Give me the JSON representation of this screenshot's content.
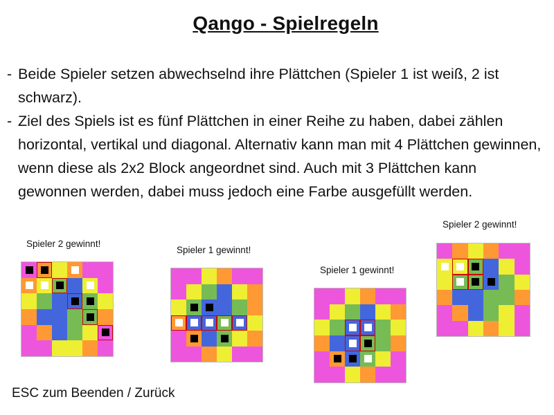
{
  "title": "Qango - Spielregeln",
  "rules": [
    "Beide Spieler setzen abwechselnd ihre Plättchen (Spieler 1 ist weiß, 2 ist schwarz).",
    "Ziel des Spiels ist es fünf Plättchen in einer Reihe zu haben, dabei zählen horizontal, vertikal und diagonal. Alternativ kann man mit 4 Plättchen gewinnen, wenn diese als 2x2 Block angeordnet sind. Auch mit 3 Plättchen kann gewonnen werden, dabei muss jedoch eine Farbe ausgefüllt werden."
  ],
  "rule_bullet": "-",
  "footer": "ESC zum Beenden / Zurück",
  "colors": {
    "M": "#ee55dd",
    "O": "#ff9933",
    "Y": "#eeee33",
    "G": "#77bb55",
    "B": "#4466dd",
    "stone_white": "#ffffff",
    "stone_black": "#000000",
    "win_highlight": "#cc0000"
  },
  "example_boards": [
    {
      "caption": "Spieler 2 gewinnt!",
      "winner": 2,
      "win_type": "diagonal five in a row",
      "cells": [
        [
          "M",
          "O",
          "Y",
          "O",
          "M",
          "M"
        ],
        [
          "O",
          "Y",
          "G",
          "B",
          "Y",
          "M"
        ],
        [
          "Y",
          "G",
          "B",
          "B",
          "G",
          "Y"
        ],
        [
          "O",
          "B",
          "B",
          "G",
          "G",
          "O"
        ],
        [
          "M",
          "O",
          "B",
          "G",
          "Y",
          "M"
        ],
        [
          "M",
          "M",
          "Y",
          "Y",
          "O",
          "M"
        ]
      ],
      "stones": [
        {
          "row": 0,
          "col": 0,
          "color": "black"
        },
        {
          "row": 0,
          "col": 1,
          "color": "black"
        },
        {
          "row": 0,
          "col": 3,
          "color": "white"
        },
        {
          "row": 1,
          "col": 0,
          "color": "white"
        },
        {
          "row": 1,
          "col": 1,
          "color": "white"
        },
        {
          "row": 1,
          "col": 2,
          "color": "black"
        },
        {
          "row": 1,
          "col": 4,
          "color": "white"
        },
        {
          "row": 2,
          "col": 3,
          "color": "black"
        },
        {
          "row": 2,
          "col": 4,
          "color": "black"
        },
        {
          "row": 3,
          "col": 4,
          "color": "black"
        },
        {
          "row": 4,
          "col": 5,
          "color": "black"
        }
      ],
      "highlights": [
        [
          0,
          1
        ],
        [
          1,
          2
        ],
        [
          2,
          3
        ],
        [
          3,
          4
        ],
        [
          4,
          5
        ]
      ]
    },
    {
      "caption": "Spieler 1 gewinnt!",
      "winner": 1,
      "win_type": "horizontal five in a row",
      "cells": [
        [
          "M",
          "M",
          "Y",
          "O",
          "M",
          "M"
        ],
        [
          "M",
          "Y",
          "G",
          "B",
          "Y",
          "O"
        ],
        [
          "Y",
          "G",
          "B",
          "B",
          "G",
          "O"
        ],
        [
          "O",
          "B",
          "B",
          "G",
          "B",
          "Y"
        ],
        [
          "M",
          "O",
          "B",
          "G",
          "Y",
          "O"
        ],
        [
          "M",
          "M",
          "O",
          "Y",
          "M",
          "M"
        ]
      ],
      "stones": [
        {
          "row": 2,
          "col": 1,
          "color": "black"
        },
        {
          "row": 2,
          "col": 2,
          "color": "black"
        },
        {
          "row": 3,
          "col": 0,
          "color": "white"
        },
        {
          "row": 3,
          "col": 1,
          "color": "white"
        },
        {
          "row": 3,
          "col": 2,
          "color": "white"
        },
        {
          "row": 3,
          "col": 3,
          "color": "white"
        },
        {
          "row": 3,
          "col": 4,
          "color": "white"
        },
        {
          "row": 4,
          "col": 1,
          "color": "black"
        },
        {
          "row": 4,
          "col": 3,
          "color": "black"
        }
      ],
      "highlights": [
        [
          3,
          0
        ],
        [
          3,
          1
        ],
        [
          3,
          2
        ],
        [
          3,
          3
        ],
        [
          3,
          4
        ]
      ]
    },
    {
      "caption": "Spieler 1 gewinnt!",
      "winner": 1,
      "win_type": "2x2 block",
      "cells": [
        [
          "M",
          "M",
          "Y",
          "O",
          "M",
          "M"
        ],
        [
          "M",
          "Y",
          "G",
          "B",
          "Y",
          "O"
        ],
        [
          "Y",
          "G",
          "B",
          "B",
          "G",
          "Y"
        ],
        [
          "O",
          "B",
          "B",
          "G",
          "G",
          "O"
        ],
        [
          "M",
          "O",
          "B",
          "G",
          "Y",
          "M"
        ],
        [
          "M",
          "M",
          "Y",
          "O",
          "M",
          "M"
        ]
      ],
      "stones": [
        {
          "row": 2,
          "col": 2,
          "color": "white"
        },
        {
          "row": 2,
          "col": 3,
          "color": "white"
        },
        {
          "row": 3,
          "col": 2,
          "color": "white"
        },
        {
          "row": 3,
          "col": 3,
          "color": "black"
        },
        {
          "row": 4,
          "col": 1,
          "color": "black"
        },
        {
          "row": 4,
          "col": 2,
          "color": "black"
        },
        {
          "row": 4,
          "col": 3,
          "color": "white"
        }
      ],
      "highlights": [
        [
          2,
          2
        ],
        [
          2,
          3
        ],
        [
          3,
          2
        ],
        [
          3,
          3
        ]
      ]
    },
    {
      "caption": "Spieler 2 gewinnt!",
      "winner": 2,
      "win_type": "three stones fill a color",
      "cells": [
        [
          "M",
          "O",
          "Y",
          "O",
          "M",
          "M"
        ],
        [
          "Y",
          "Y",
          "G",
          "B",
          "Y",
          "M"
        ],
        [
          "Y",
          "G",
          "G",
          "B",
          "G",
          "Y"
        ],
        [
          "O",
          "B",
          "B",
          "G",
          "G",
          "O"
        ],
        [
          "M",
          "O",
          "B",
          "G",
          "Y",
          "M"
        ],
        [
          "M",
          "M",
          "Y",
          "O",
          "Y",
          "M"
        ]
      ],
      "stones": [
        {
          "row": 1,
          "col": 0,
          "color": "white"
        },
        {
          "row": 1,
          "col": 1,
          "color": "white"
        },
        {
          "row": 1,
          "col": 2,
          "color": "black"
        },
        {
          "row": 2,
          "col": 1,
          "color": "white"
        },
        {
          "row": 2,
          "col": 2,
          "color": "black"
        },
        {
          "row": 2,
          "col": 3,
          "color": "black"
        }
      ],
      "highlights": [
        [
          1,
          1
        ],
        [
          1,
          2
        ],
        [
          2,
          1
        ],
        [
          2,
          2
        ]
      ]
    }
  ]
}
